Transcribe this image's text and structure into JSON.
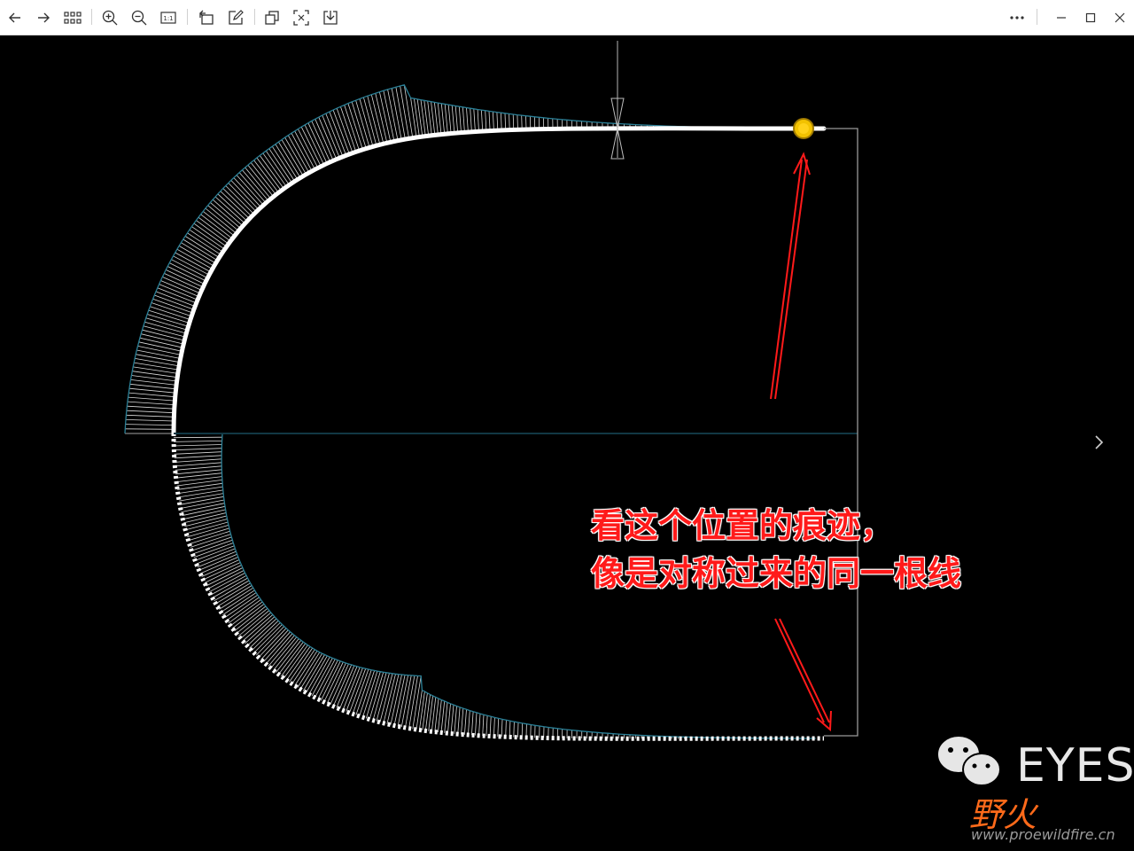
{
  "toolbar": {
    "left_buttons": [
      {
        "name": "back-button",
        "icon": "arrow-left-icon"
      },
      {
        "name": "forward-button",
        "icon": "arrow-right-icon"
      },
      {
        "name": "grid-view-button",
        "icon": "grid-icon"
      },
      {
        "name": "zoom-in-button",
        "icon": "zoom-in-icon"
      },
      {
        "name": "zoom-out-button",
        "icon": "zoom-out-icon"
      },
      {
        "name": "actual-size-button",
        "icon": "one-to-one-icon",
        "label": "1:1"
      },
      {
        "name": "rotate-button",
        "icon": "rotate-icon"
      },
      {
        "name": "edit-button",
        "icon": "edit-icon"
      },
      {
        "name": "copy-button",
        "icon": "copy-icon"
      },
      {
        "name": "ocr-button",
        "icon": "text-scan-icon"
      },
      {
        "name": "save-button",
        "icon": "download-icon"
      }
    ],
    "right_buttons": [
      {
        "name": "more-button",
        "icon": "more-icon",
        "label": "···"
      },
      {
        "name": "minimize-button",
        "icon": "minimize-icon"
      },
      {
        "name": "maximize-button",
        "icon": "maximize-icon"
      },
      {
        "name": "close-button",
        "icon": "close-icon"
      }
    ]
  },
  "annotation": {
    "line1": "看这个位置的痕迹，",
    "line2": "像是对称过来的同一根线",
    "color": "#ff1a1a"
  },
  "watermark": {
    "brand": "EYESI",
    "chinese": "野火",
    "site": "www.proewildfire.cn"
  },
  "colors": {
    "background": "#000000",
    "curve": "#ffffff",
    "hatch_outline": "#2a7f96",
    "marker": "#f2c200",
    "arrow": "#ff1a1a"
  },
  "viewer": {
    "next_icon": "chevron-right-icon"
  }
}
